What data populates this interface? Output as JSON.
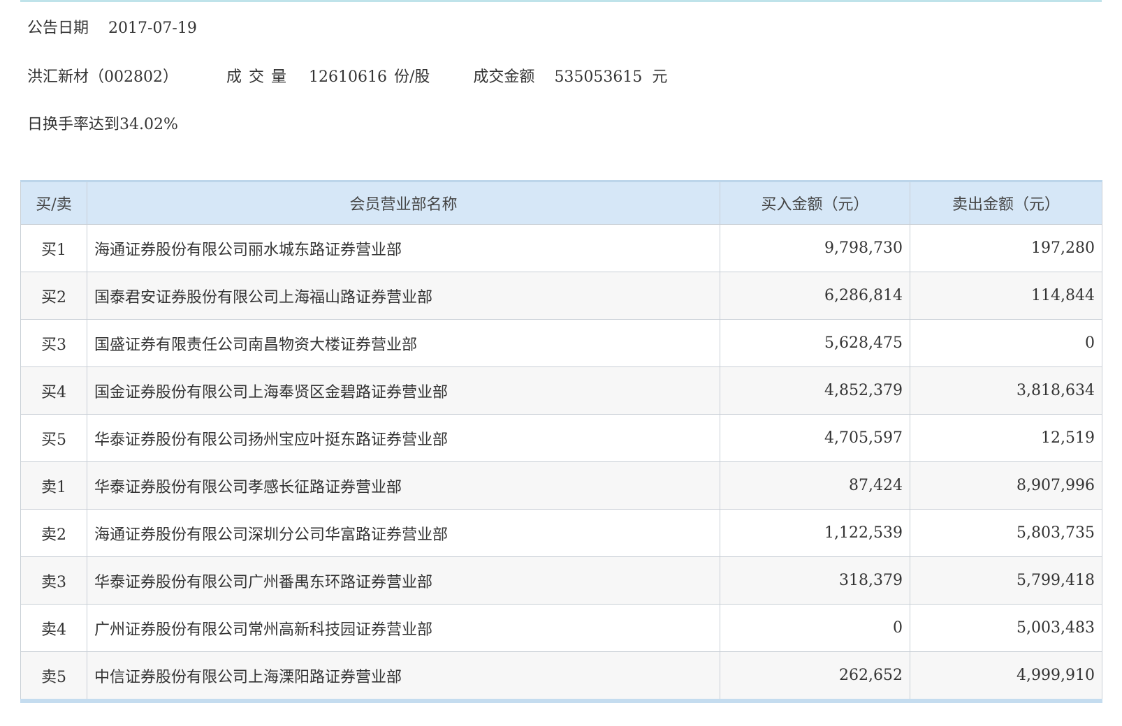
{
  "header": {
    "date_label": "公告日期",
    "date_value": "2017-07-19",
    "stock_name": "洪汇新材（002802）",
    "volume_label": "成交量",
    "volume_value": "12610616",
    "volume_unit": "份/股",
    "amount_label": "成交金额",
    "amount_value": "535053615",
    "amount_unit": "元",
    "reason": "日换手率达到34.02%"
  },
  "table": {
    "columns": [
      "买/卖",
      "会员营业部名称",
      "买入金额（元）",
      "卖出金额（元）"
    ],
    "rows": [
      {
        "type": "买1",
        "name": "海通证券股份有限公司丽水城东路证券营业部",
        "buy": "9,798,730",
        "sell": "197,280"
      },
      {
        "type": "买2",
        "name": "国泰君安证券股份有限公司上海福山路证券营业部",
        "buy": "6,286,814",
        "sell": "114,844"
      },
      {
        "type": "买3",
        "name": "国盛证券有限责任公司南昌物资大楼证券营业部",
        "buy": "5,628,475",
        "sell": "0"
      },
      {
        "type": "买4",
        "name": "国金证券股份有限公司上海奉贤区金碧路证券营业部",
        "buy": "4,852,379",
        "sell": "3,818,634"
      },
      {
        "type": "买5",
        "name": "华泰证券股份有限公司扬州宝应叶挺东路证券营业部",
        "buy": "4,705,597",
        "sell": "12,519"
      },
      {
        "type": "卖1",
        "name": "华泰证券股份有限公司孝感长征路证券营业部",
        "buy": "87,424",
        "sell": "8,907,996"
      },
      {
        "type": "卖2",
        "name": "海通证券股份有限公司深圳分公司华富路证券营业部",
        "buy": "1,122,539",
        "sell": "5,803,735"
      },
      {
        "type": "卖3",
        "name": "华泰证券股份有限公司广州番禺东环路证券营业部",
        "buy": "318,379",
        "sell": "5,799,418"
      },
      {
        "type": "卖4",
        "name": "广州证券股份有限公司常州高新科技园证券营业部",
        "buy": "0",
        "sell": "5,003,483"
      },
      {
        "type": "卖5",
        "name": "中信证券股份有限公司上海溧阳路证券营业部",
        "buy": "262,652",
        "sell": "4,999,910"
      }
    ]
  }
}
